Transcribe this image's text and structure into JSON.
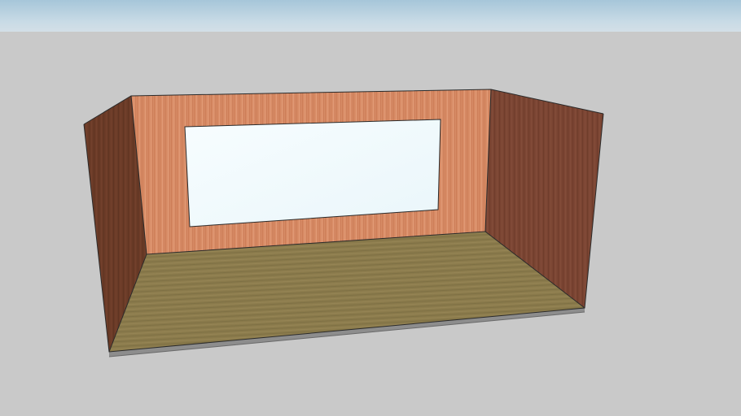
{
  "viewport": {
    "sky_color": "#b8d1e0",
    "ground_color": "#c9c9c9"
  },
  "model": {
    "parts": [
      {
        "name": "left-wall",
        "color": "#6a3a25"
      },
      {
        "name": "back-wall",
        "color": "#d98a63"
      },
      {
        "name": "right-wall",
        "color": "#7a4330"
      },
      {
        "name": "floor",
        "color": "#8a7a4a"
      },
      {
        "name": "screen-panel",
        "color": "#f4fbfd"
      },
      {
        "name": "floor-base-edge",
        "color": "#8d8d8d"
      }
    ]
  }
}
